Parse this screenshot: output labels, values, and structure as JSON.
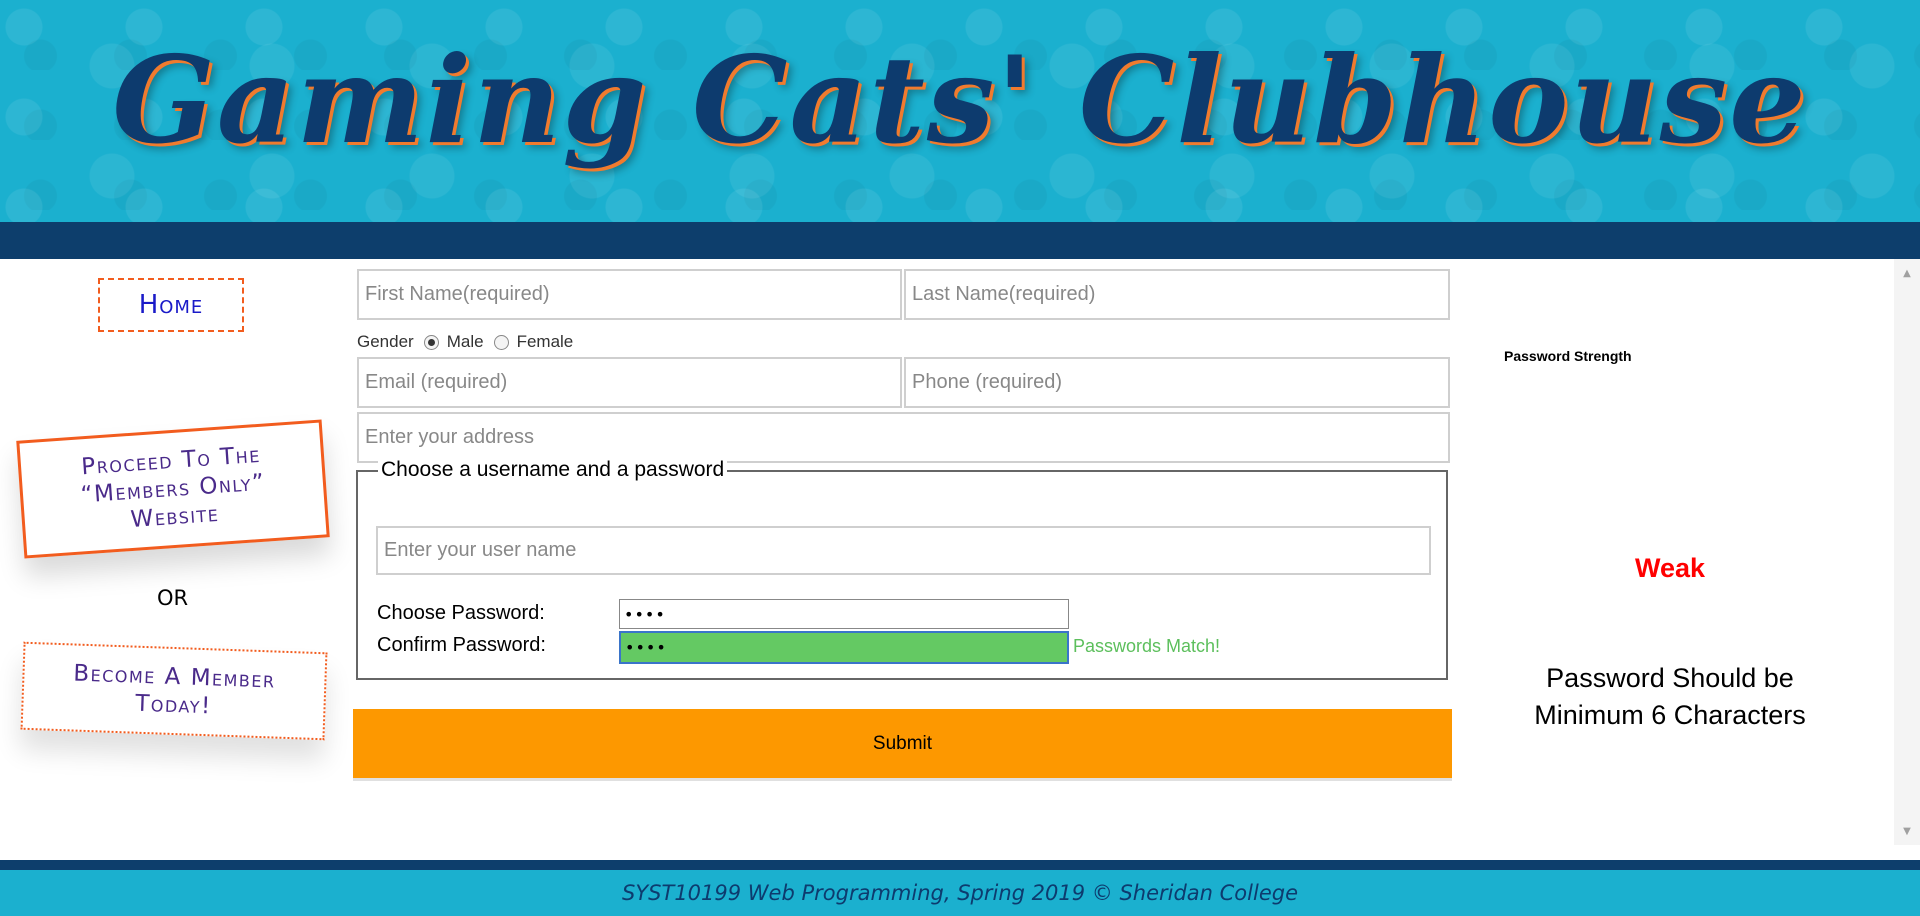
{
  "header": {
    "title": "Gaming Cats' Clubhouse"
  },
  "nav": {
    "home": "Home",
    "proceed": "Proceed To The “Members Only” Website",
    "or": "OR",
    "become": "Become A Member Today!"
  },
  "form": {
    "first_name_placeholder": "First Name(required)",
    "last_name_placeholder": "Last Name(required)",
    "gender_label": "Gender",
    "gender_options": [
      {
        "label": "Male",
        "checked": true
      },
      {
        "label": "Female",
        "checked": false
      }
    ],
    "email_placeholder": "Email (required)",
    "phone_placeholder": "Phone (required)",
    "address_placeholder": "Enter your address",
    "credentials": {
      "legend": "Choose a username and a password",
      "username_placeholder": "Enter your user name",
      "choose_password_label": "Choose Password:",
      "choose_password_value": "••••",
      "confirm_password_label": "Confirm Password:",
      "confirm_password_value": "••••",
      "match_message": "Passwords Match!"
    },
    "submit_label": "Submit"
  },
  "strength": {
    "label": "Password Strength",
    "value": "Weak",
    "note": "Password Should be Minimum 6 Characters"
  },
  "footer": {
    "text": "SYST10199 Web Programming, Spring 2019 © Sheridan College"
  },
  "colors": {
    "header_bg": "#1bb0cf",
    "navy_bar": "#0d3e6c",
    "accent_orange": "#fd9800",
    "nav_border": "#f25c1e",
    "match_green": "#64c963",
    "weak_red": "#ff0000"
  },
  "icons": {
    "scroll_up": "scroll-up-arrow-icon",
    "scroll_down": "scroll-down-arrow-icon"
  }
}
